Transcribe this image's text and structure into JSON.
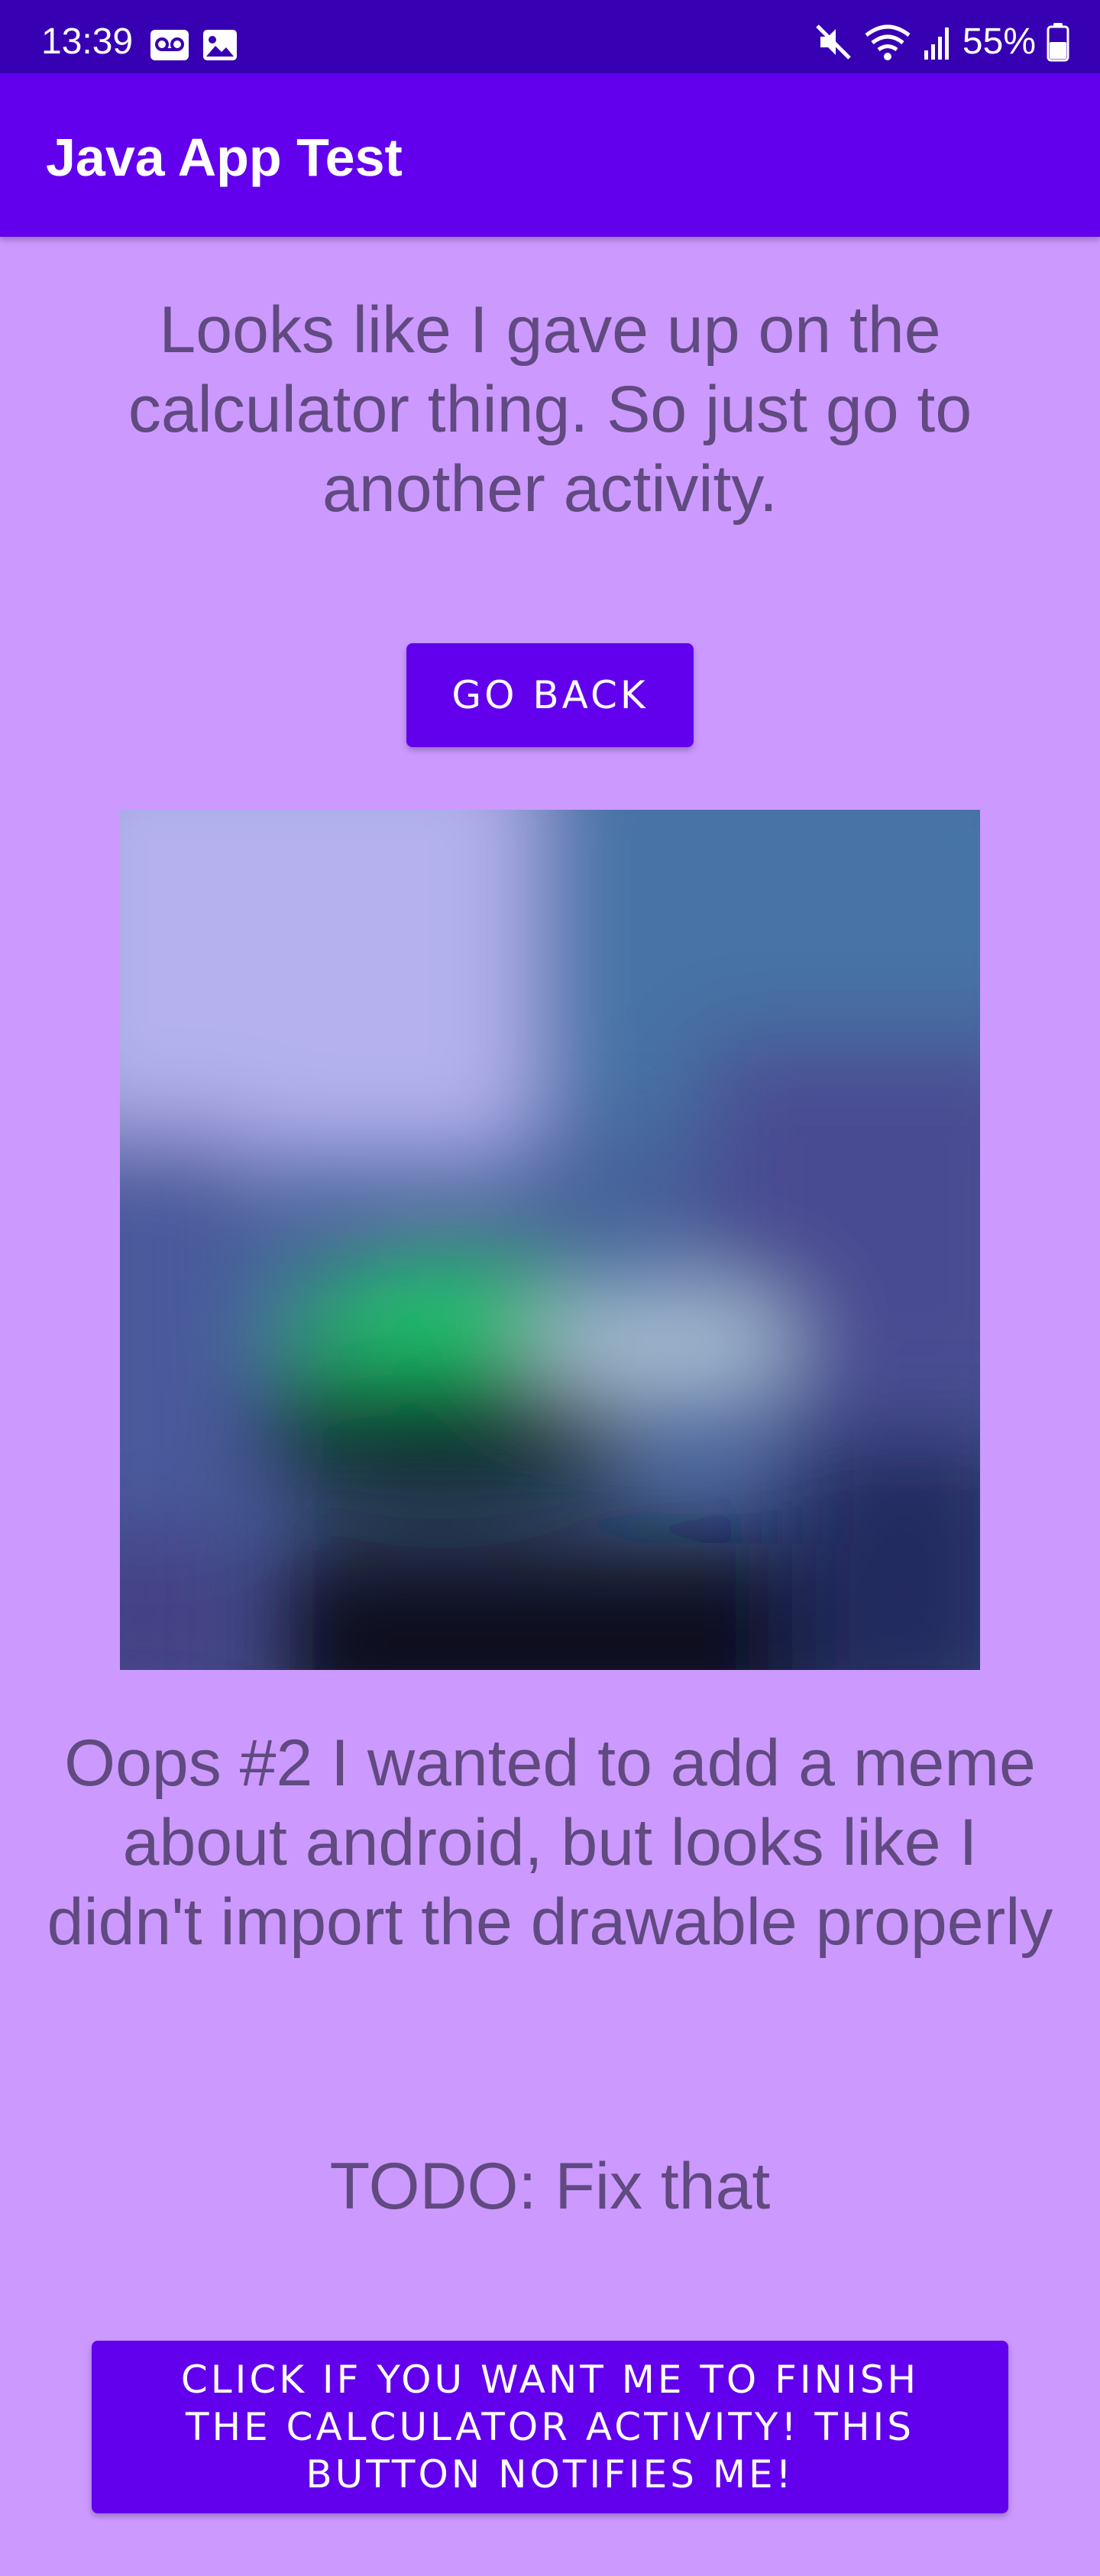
{
  "status_bar": {
    "time": "13:39",
    "battery": "55%",
    "icons_left": [
      "voicemail-icon",
      "image-icon"
    ],
    "icons_right": [
      "mute-icon",
      "wifi-icon",
      "signal-icon",
      "battery-icon"
    ]
  },
  "app_bar": {
    "title": "Java App Test"
  },
  "content": {
    "intro_text": "Looks like I gave up on the calculator thing. So just go to another activity.",
    "go_back_label": "GO BACK",
    "oops_text": "Oops #2 I wanted to add a meme about android, but looks like I didn't import the drawable properly",
    "todo_text": "TODO: Fix that",
    "notify_label": "CLICK IF YOU WANT ME TO FINISH THE CALCULATOR ACTIVITY! THIS BUTTON NOTIFIES ME!"
  },
  "colors": {
    "background": "#cc99ff",
    "primary": "#6200ee",
    "primary_dark": "#3700b3",
    "body_text": "#604a80"
  }
}
